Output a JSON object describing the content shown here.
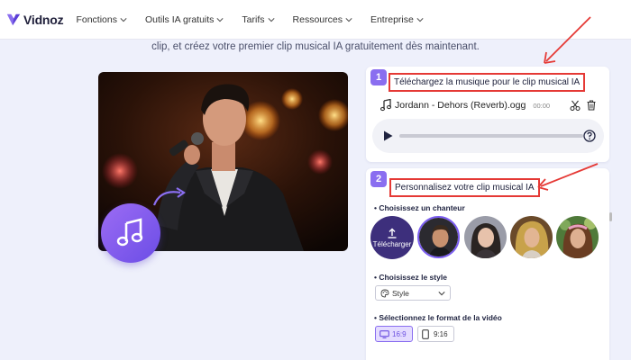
{
  "header": {
    "brand": "Vidnoz",
    "nav": [
      {
        "label": "Fonctions"
      },
      {
        "label": "Outils IA gratuits"
      },
      {
        "label": "Tarifs"
      },
      {
        "label": "Ressources"
      },
      {
        "label": "Entreprise"
      }
    ]
  },
  "intro": "clip, et créez votre premier clip musical IA gratuitement dès maintenant.",
  "step1": {
    "number": "1",
    "title": "Téléchargez la musique pour le clip musical IA",
    "file_name": "Jordann - Dehors (Reverb).ogg",
    "file_time": "00:00",
    "icons": [
      "music-note-icon",
      "scissors-icon",
      "trash-icon",
      "play-icon",
      "help-icon"
    ]
  },
  "step2": {
    "number": "2",
    "title": "Personnalisez votre clip musical IA",
    "singer_label": "• Choisissez un chanteur",
    "upload_label": "Télécharger",
    "style_label": "• Choisissez le style",
    "style_value": "Style",
    "format_label": "• Sélectionnez le format de la vidéo",
    "formats": [
      {
        "label": "16:9",
        "selected": true
      },
      {
        "label": "9:16",
        "selected": false
      }
    ]
  },
  "colors": {
    "accent": "#8a6ef0",
    "highlight_box": "#e53935",
    "background": "#eef0fb"
  }
}
